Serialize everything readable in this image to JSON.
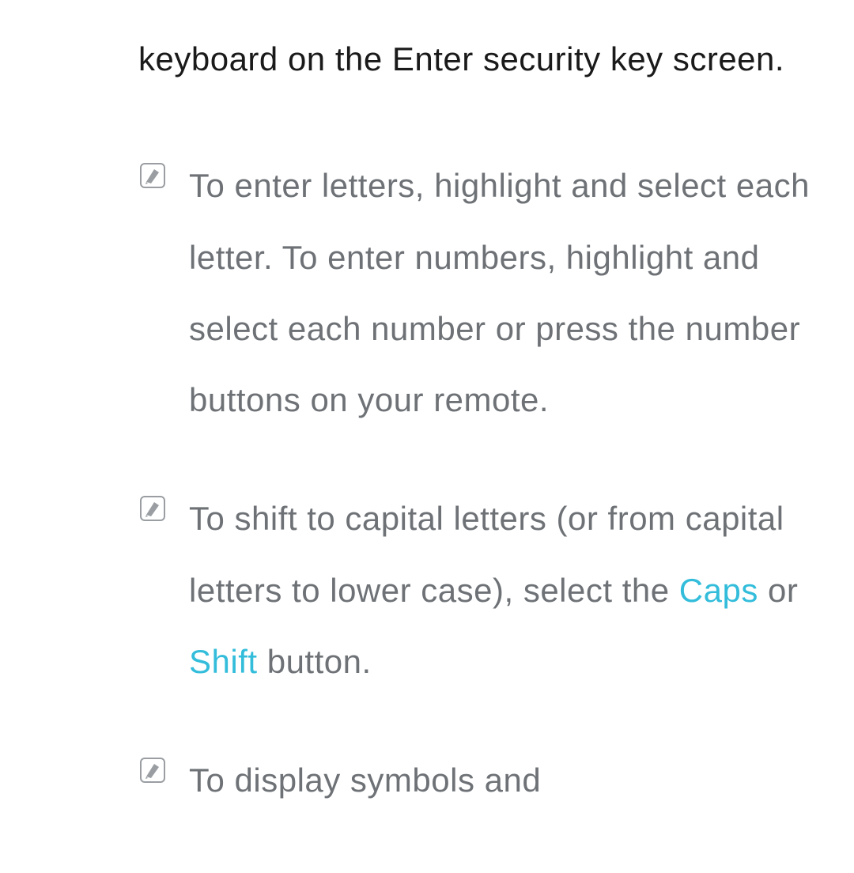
{
  "intro": "keyboard on the Enter security key screen.",
  "notes": [
    {
      "text": "To enter letters, highlight and select each letter. To enter numbers, highlight and select each number or press the number buttons on your remote."
    },
    {
      "before": "To shift to capital letters (or from capital letters to lower case), select the ",
      "highlight1": "Caps",
      "mid": " or ",
      "highlight2": "Shift",
      "after": " button."
    },
    {
      "text": "To display symbols and"
    }
  ]
}
